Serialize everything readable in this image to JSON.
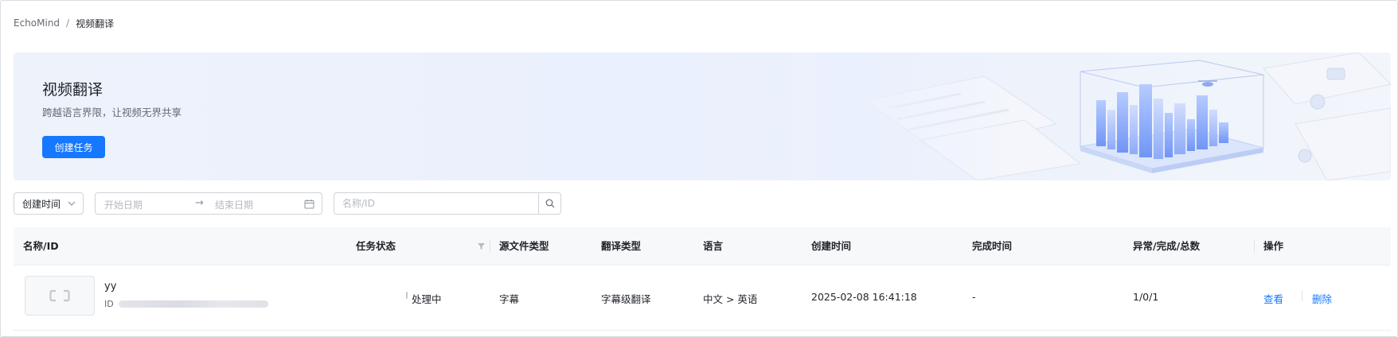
{
  "breadcrumb": {
    "root": "EchoMind",
    "separator": "/",
    "current": "视频翻译"
  },
  "banner": {
    "title": "视频翻译",
    "subtitle": "跨越语言界限，让视频无界共享",
    "create_button": "创建任务"
  },
  "filters": {
    "sort_select": "创建时间",
    "date_start_placeholder": "开始日期",
    "date_arrow": "→",
    "date_end_placeholder": "结束日期",
    "search_placeholder": "名称/ID"
  },
  "table": {
    "columns": [
      "名称/ID",
      "任务状态",
      "源文件类型",
      "翻译类型",
      "语言",
      "创建时间",
      "完成时间",
      "异常/完成/总数",
      "操作"
    ],
    "rows": [
      {
        "name": "yy",
        "id_label": "ID",
        "status": "处理中",
        "source_type": "字幕",
        "translate_type": "字幕级翻译",
        "language": "中文 > 英语",
        "created": "2025-02-08 16:41:18",
        "finished": "-",
        "counts": "1/0/1",
        "action_view": "查看",
        "action_delete": "删除"
      }
    ]
  },
  "colors": {
    "primary": "#1677ff",
    "header_bg": "#f7f8fa",
    "banner_bg": "#eaf0fd"
  }
}
